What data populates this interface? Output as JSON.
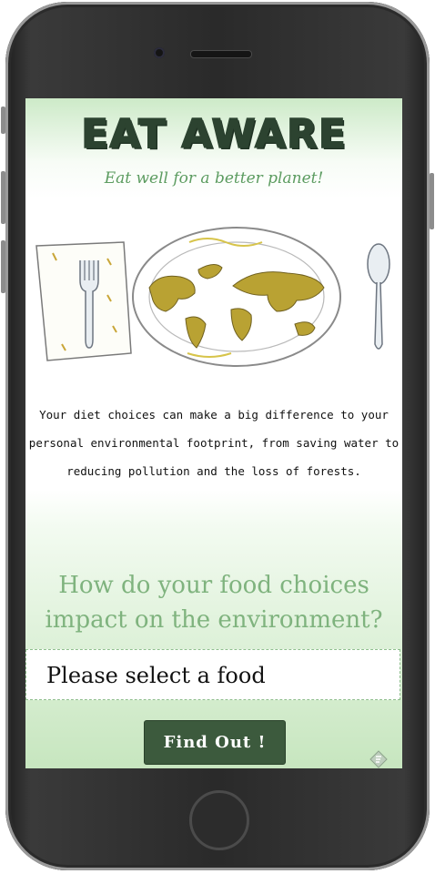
{
  "app": {
    "title": "EAT AWARE",
    "tagline": "Eat well for a better planet!"
  },
  "intro": {
    "text": "Your diet choices can make a big difference to your personal environmental footprint, from saving water to reducing pollution and the loss of forests."
  },
  "question": {
    "text": "How do your food choices impact on the environment?"
  },
  "food_select": {
    "selected": "Please select a food"
  },
  "find_button": {
    "label": "Find Out !"
  },
  "icons": [
    "plate-world-map-illustration",
    "fork-icon",
    "spoon-icon",
    "napkin-icon",
    "badge-icon"
  ],
  "colors": {
    "title": "#2c4330",
    "accent_green": "#7fb37e",
    "button": "#3c5a3d"
  }
}
